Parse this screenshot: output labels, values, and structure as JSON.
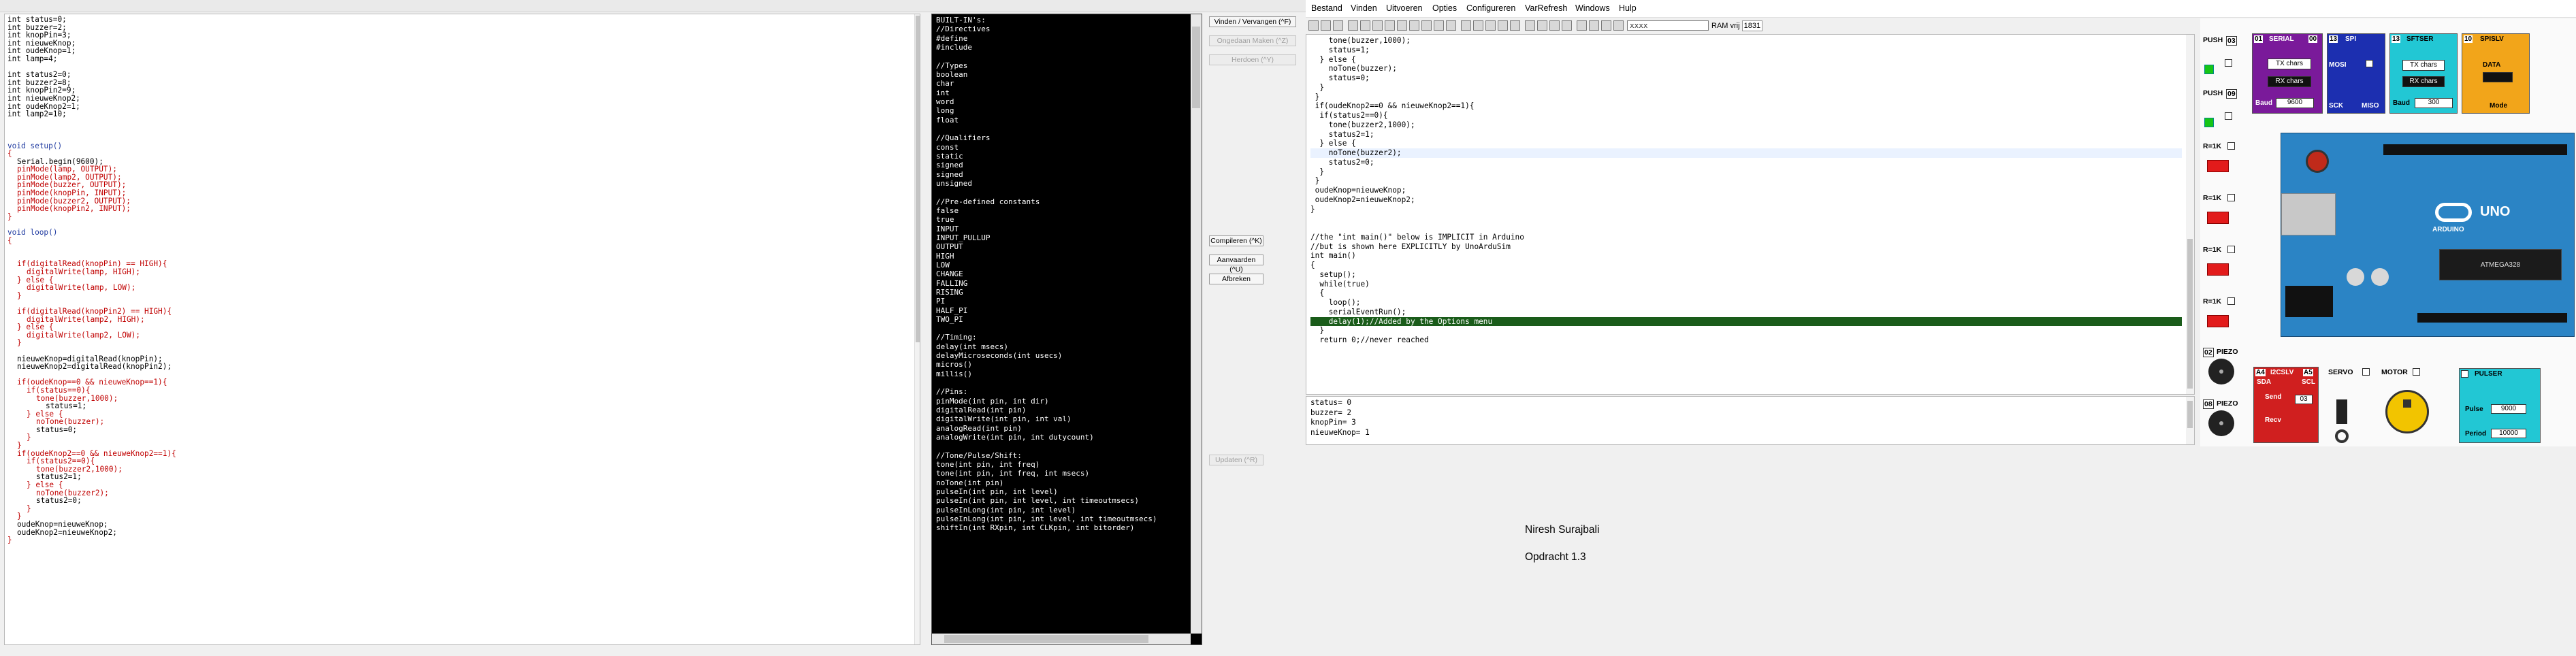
{
  "editor": {
    "lines": [
      {
        "t": "int status=0;",
        "l": 0
      },
      {
        "t": "int buzzer=2;",
        "l": 0
      },
      {
        "t": "int knopPin=3;",
        "l": 0
      },
      {
        "t": "int nieuweKnop;",
        "l": 0
      },
      {
        "t": "int oudeKnop=1;",
        "l": 0
      },
      {
        "t": "int lamp=4;",
        "l": 0
      },
      {
        "t": "",
        "l": 0
      },
      {
        "t": "int status2=0;",
        "l": 0
      },
      {
        "t": "int buzzer2=8;",
        "l": 0
      },
      {
        "t": "int knopPin2=9;",
        "l": 0
      },
      {
        "t": "int nieuweKnop2;",
        "l": 0
      },
      {
        "t": "int oudeKnop2=1;",
        "l": 0
      },
      {
        "t": "int lamp2=10;",
        "l": 0
      },
      {
        "t": "",
        "l": 0
      },
      {
        "t": "",
        "l": 0
      },
      {
        "t": "",
        "l": 0
      },
      {
        "t": "void setup()",
        "l": 0,
        "c": "kw"
      },
      {
        "t": "{",
        "l": 0,
        "c": "fn"
      },
      {
        "t": "Serial.begin(9600);",
        "l": 1
      },
      {
        "t": "pinMode(lamp, OUTPUT);",
        "l": 1,
        "c": "fn"
      },
      {
        "t": "pinMode(lamp2, OUTPUT);",
        "l": 1,
        "c": "fn"
      },
      {
        "t": "pinMode(buzzer, OUTPUT);",
        "l": 1,
        "c": "fn"
      },
      {
        "t": "pinMode(knopPin, INPUT);",
        "l": 1,
        "c": "fn"
      },
      {
        "t": "pinMode(buzzer2, OUTPUT);",
        "l": 1,
        "c": "fn"
      },
      {
        "t": "pinMode(knopPin2, INPUT);",
        "l": 1,
        "c": "fn"
      },
      {
        "t": "}",
        "l": 0,
        "c": "fn"
      },
      {
        "t": "",
        "l": 0
      },
      {
        "t": "void loop()",
        "l": 0,
        "c": "kw"
      },
      {
        "t": "{",
        "l": 0,
        "c": "fn"
      },
      {
        "t": "",
        "l": 0
      },
      {
        "t": "",
        "l": 0
      },
      {
        "t": "if(digitalRead(knopPin) == HIGH){",
        "l": 1,
        "c": "fn"
      },
      {
        "t": "digitalWrite(lamp, HIGH);",
        "l": 2,
        "c": "fn"
      },
      {
        "t": "} else {",
        "l": 1,
        "c": "fn"
      },
      {
        "t": "digitalWrite(lamp, LOW);",
        "l": 2,
        "c": "fn"
      },
      {
        "t": "}",
        "l": 1,
        "c": "fn"
      },
      {
        "t": "",
        "l": 0
      },
      {
        "t": "if(digitalRead(knopPin2) == HIGH){",
        "l": 1,
        "c": "fn"
      },
      {
        "t": "digitalWrite(lamp2, HIGH);",
        "l": 2,
        "c": "fn"
      },
      {
        "t": "} else {",
        "l": 1,
        "c": "fn"
      },
      {
        "t": "digitalWrite(lamp2, LOW);",
        "l": 2,
        "c": "fn"
      },
      {
        "t": "}",
        "l": 1,
        "c": "fn"
      },
      {
        "t": "",
        "l": 0
      },
      {
        "t": "nieuweKnop=digitalRead(knopPin);",
        "l": 1
      },
      {
        "t": "nieuweKnop2=digitalRead(knopPin2);",
        "l": 1
      },
      {
        "t": "",
        "l": 0
      },
      {
        "t": "if(oudeKnop==0 && nieuweKnop==1){",
        "l": 1,
        "c": "fn"
      },
      {
        "t": "if(status==0){",
        "l": 2,
        "c": "fn"
      },
      {
        "t": "tone(buzzer,1000);",
        "l": 3,
        "c": "fn"
      },
      {
        "t": "status=1;",
        "l": 4
      },
      {
        "t": "} else {",
        "l": 2,
        "c": "fn"
      },
      {
        "t": "noTone(buzzer);",
        "l": 3,
        "c": "fn"
      },
      {
        "t": "status=0;",
        "l": 3
      },
      {
        "t": "}",
        "l": 2,
        "c": "fn"
      },
      {
        "t": "}",
        "l": 1,
        "c": "fn"
      },
      {
        "t": "if(oudeKnop2==0 && nieuweKnop2==1){",
        "l": 1,
        "c": "fn"
      },
      {
        "t": "if(status2==0){",
        "l": 2,
        "c": "fn"
      },
      {
        "t": "tone(buzzer2,1000);",
        "l": 3,
        "c": "fn"
      },
      {
        "t": "status2=1;",
        "l": 3
      },
      {
        "t": "} else {",
        "l": 2,
        "c": "fn"
      },
      {
        "t": "noTone(buzzer2);",
        "l": 3,
        "c": "fn"
      },
      {
        "t": "status2=0;",
        "l": 3
      },
      {
        "t": "}",
        "l": 2,
        "c": "fn"
      },
      {
        "t": "}",
        "l": 1,
        "c": "fn"
      },
      {
        "t": "oudeKnop=nieuweKnop;",
        "l": 1
      },
      {
        "t": "oudeKnop2=nieuweKnop2;",
        "l": 1
      },
      {
        "t": "}",
        "l": 0,
        "c": "fn"
      }
    ]
  },
  "builtins": {
    "lines": [
      "BUILT-IN's:",
      "//Directives",
      "#define",
      "#include",
      "",
      "//Types",
      "boolean",
      "char",
      "int",
      "word",
      "long",
      "float",
      "",
      "//Qualifiers",
      "const",
      "static",
      "signed",
      "signed",
      "unsigned",
      "",
      "//Pre-defined constants",
      "false",
      "true",
      "INPUT",
      "INPUT_PULLUP",
      "OUTPUT",
      "HIGH",
      "LOW",
      "CHANGE",
      "FALLING",
      "RISING",
      "PI",
      "HALF_PI",
      "TWO_PI",
      "",
      "//Timing:",
      "delay(int msecs)",
      "delayMicroseconds(int usecs)",
      "micros()",
      "millis()",
      "",
      "//Pins:",
      "pinMode(int pin, int dir)",
      "digitalRead(int pin)",
      "digitalWrite(int pin, int val)",
      "analogRead(int pin)",
      "analogWrite(int pin, int dutycount)",
      "",
      "//Tone/Pulse/Shift:",
      "tone(int pin, int freq)",
      "tone(int pin, int freq, int msecs)",
      "noTone(int pin)",
      "pulseIn(int pin, int level)",
      "pulseIn(int pin, int level, int timeoutmsecs)",
      "pulseInLong(int pin, int level)",
      "pulseInLong(int pin, int level, int timeoutmsecs)",
      "shiftIn(int RXpin, int CLKpin, int bitorder)"
    ]
  },
  "side_buttons": {
    "find_replace": "Vinden / Vervangen (^F)",
    "next_find": "Ongedaan Maken (^Z)",
    "redo": "Herdoen (^Y)",
    "compile": "Compileren (^K)",
    "save": "Aanvaarden (^U)",
    "cancel": "Afbreken",
    "update": "Updaten (^R)"
  },
  "menubar": {
    "items": [
      "Bestand",
      "Vinden",
      "Uitvoeren",
      "Opties",
      "Configureren",
      "VarRefresh",
      "Windows",
      "Hulp"
    ]
  },
  "toolbar": {
    "search_text": "xxxx",
    "ram_label": "RAM vrij",
    "ram_value": "1831"
  },
  "sim_code": {
    "lines": [
      {
        "t": "    tone(buzzer,1000);"
      },
      {
        "t": "    status=1;"
      },
      {
        "t": "  } else {"
      },
      {
        "t": "    noTone(buzzer);"
      },
      {
        "t": "    status=0;"
      },
      {
        "t": "  }"
      },
      {
        "t": " }"
      },
      {
        "t": " if(oudeKnop2==0 && nieuweKnop2==1){"
      },
      {
        "t": "  if(status2==0){"
      },
      {
        "t": "    tone(buzzer2,1000);"
      },
      {
        "t": "    status2=1;"
      },
      {
        "t": "  } else {"
      },
      {
        "t": "    noTone(buzzer2);",
        "cls": "cur"
      },
      {
        "t": "    status2=0;"
      },
      {
        "t": "  }"
      },
      {
        "t": " }"
      },
      {
        "t": " oudeKnop=nieuweKnop;"
      },
      {
        "t": " oudeKnop2=nieuweKnop2;"
      },
      {
        "t": "}"
      },
      {
        "t": ""
      },
      {
        "t": ""
      },
      {
        "t": "//the \"int main()\" below is IMPLICIT in Arduino"
      },
      {
        "t": "//but is shown here EXPLICITLY by UnoArduSim"
      },
      {
        "t": "int main()"
      },
      {
        "t": "{"
      },
      {
        "t": "  setup();"
      },
      {
        "t": "  while(true)"
      },
      {
        "t": "  {"
      },
      {
        "t": "    loop();"
      },
      {
        "t": "    serialEventRun();"
      },
      {
        "t": "    delay(1);//Added by the Options menu",
        "cls": "hl"
      },
      {
        "t": "  }"
      },
      {
        "t": "  return 0;//never reached"
      }
    ]
  },
  "sim_vars": {
    "lines": [
      "status= 0",
      "buzzer= 2",
      "knopPin= 3",
      "nieuweKnop= 1"
    ]
  },
  "slide": {
    "author": "Niresh Surajbali",
    "title": "Opdracht 1.3"
  },
  "hardware": {
    "push1_label": "PUSH",
    "push1_pin": "03",
    "push2_label": "PUSH",
    "push2_pin": "09",
    "r1k_label": "R=1K",
    "led_pins": [
      "01",
      "02",
      "03",
      "04"
    ],
    "serial_label": "SERIAL",
    "serial_pins": [
      "01",
      "00"
    ],
    "tx_chars": "TX chars",
    "rx_chars": "RX chars",
    "baud_label": "Baud",
    "baud_value": "9600",
    "spi_label": "SPI",
    "spi_pin": "13",
    "softser_label": "SFTSER",
    "softser_baud": "300",
    "spi_mosi": "MOSI",
    "spi_sck": "SCK",
    "spi_miso": "MISO",
    "spislv_label": "SPISLV",
    "spislv_pin": "10",
    "data_label": "DATA",
    "mode_label": "Mode",
    "piezo_label": "PIEZO",
    "piezo_pins": [
      "02",
      "08"
    ],
    "i2cslv_label": "I2CSLV",
    "i2c_addr": "03",
    "i2c_sda": "SDA",
    "i2c_scl": "SCL",
    "send_label": "Send",
    "recv_label": "Recv",
    "servo_label": "SERVO",
    "motor_label": "MOTOR",
    "pulser_label": "PULSER",
    "pulse_label": "Pulse",
    "pulse_value": "9000",
    "period_label": "Period",
    "period_value": "10000",
    "uno_label": "UNO",
    "arduino_label": "ARDUINO",
    "chip_label": "ATMEGA328",
    "a4_label": "A4",
    "a5_label": "A5"
  },
  "colors": {
    "highlight_line": "#1a5c1a",
    "serial_panel": "#7a1a9a",
    "spi_panel": "#1c2fb0",
    "sftser_panel": "#22c7d4",
    "spislv_panel": "#f2a51a",
    "i2c_panel": "#d01f1f",
    "pulser_panel": "#22c7d4",
    "board_blue": "#2b84c5"
  }
}
